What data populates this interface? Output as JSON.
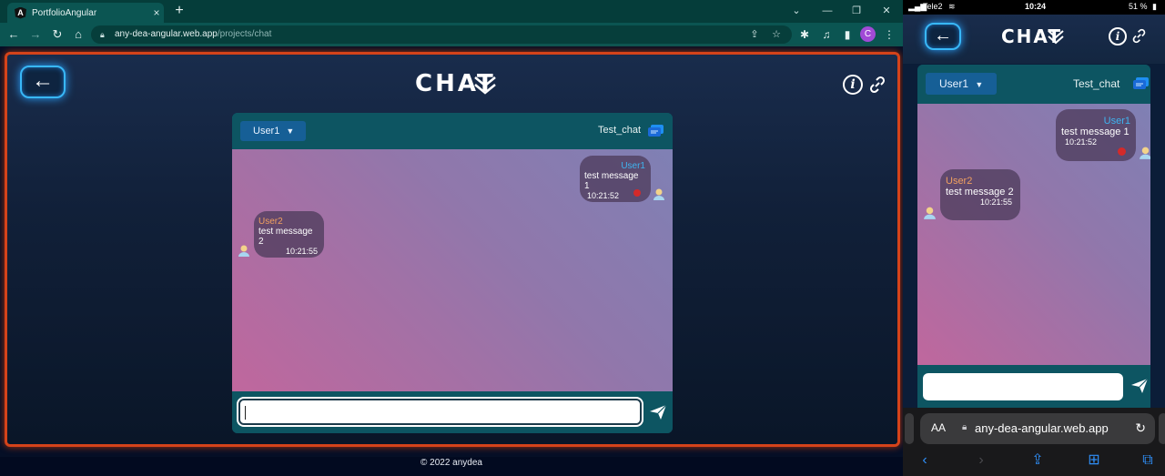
{
  "browser": {
    "tab_title": "PortfolioAngular",
    "tab_favicon_letter": "A",
    "tab_close": "×",
    "new_tab": "+",
    "url_host": "any-dea-angular.web.app",
    "url_path": "/projects/chat",
    "profile_initial": "C"
  },
  "app": {
    "title": "CHAT",
    "footer": "© 2022 anydea",
    "colors": {
      "frame_border": "#d5431a",
      "neon_blue": "#38b8f8",
      "header_teal": "#0d5562"
    }
  },
  "chat": {
    "current_user": "User1",
    "chat_name": "Test_chat",
    "input_value": "",
    "messages": [
      {
        "from": "User1",
        "text": "test message 1",
        "time": "10:21:52",
        "mine": true
      },
      {
        "from": "User2",
        "text": "test message 2",
        "time": "10:21:55",
        "mine": false
      }
    ]
  },
  "phone": {
    "carrier": "Tele2",
    "time": "10:24",
    "battery": "51 %",
    "safari_aa": "AA",
    "safari_url": "any-dea-angular.web.app"
  }
}
